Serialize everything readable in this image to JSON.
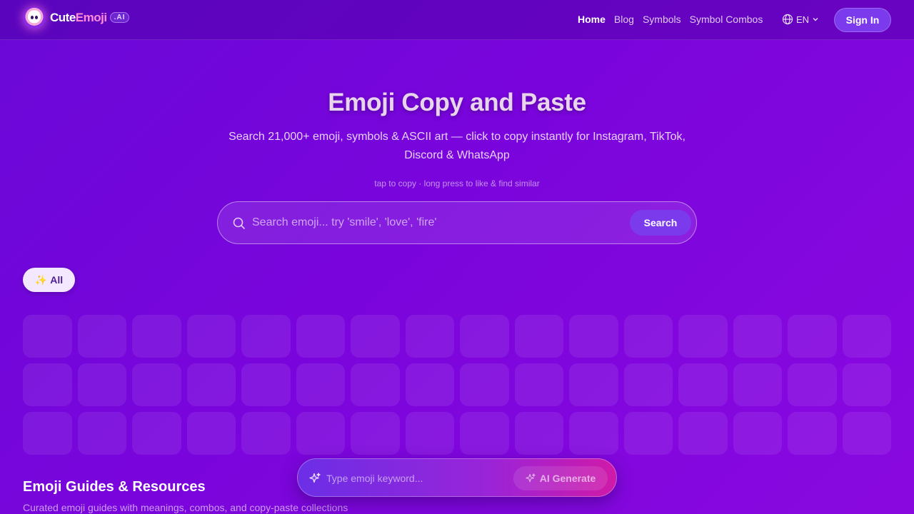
{
  "nav": {
    "brand_cute": "Cute",
    "brand_emoji": "Emoji",
    "brand_badge": ".AI",
    "links": [
      {
        "label": "Home",
        "active": true
      },
      {
        "label": "Blog",
        "active": false
      },
      {
        "label": "Symbols",
        "active": false
      },
      {
        "label": "Symbol Combos",
        "active": false
      }
    ],
    "language": "EN",
    "signin_label": "Sign In"
  },
  "hero": {
    "title": "Emoji Copy and Paste",
    "subtitle": "Search 21,000+ emoji, symbols & ASCII art — click to copy instantly for Instagram, TikTok, Discord & WhatsApp",
    "hint": "tap to copy · long press to like & find similar"
  },
  "search": {
    "placeholder": "Search emoji... try 'smile', 'love', 'fire'",
    "button_label": "Search",
    "icon": "search-icon"
  },
  "categories": {
    "active_chip_icon": "✨",
    "active_chip_label": "All"
  },
  "emoji_grid": {
    "loading": true
  },
  "guides": {
    "title": "Emoji Guides & Resources",
    "subtitle": "Curated emoji guides with meanings, combos, and copy-paste collections"
  },
  "ai_bar": {
    "placeholder": "Type emoji keyword...",
    "button_label": "AI Generate",
    "icon": "sparkle-icon"
  },
  "colors": {
    "accent": "#7c3aed",
    "chip_bg": "#f3e8ff",
    "chip_text": "#4c1d95",
    "brand_pink": "#ff8ad8"
  }
}
